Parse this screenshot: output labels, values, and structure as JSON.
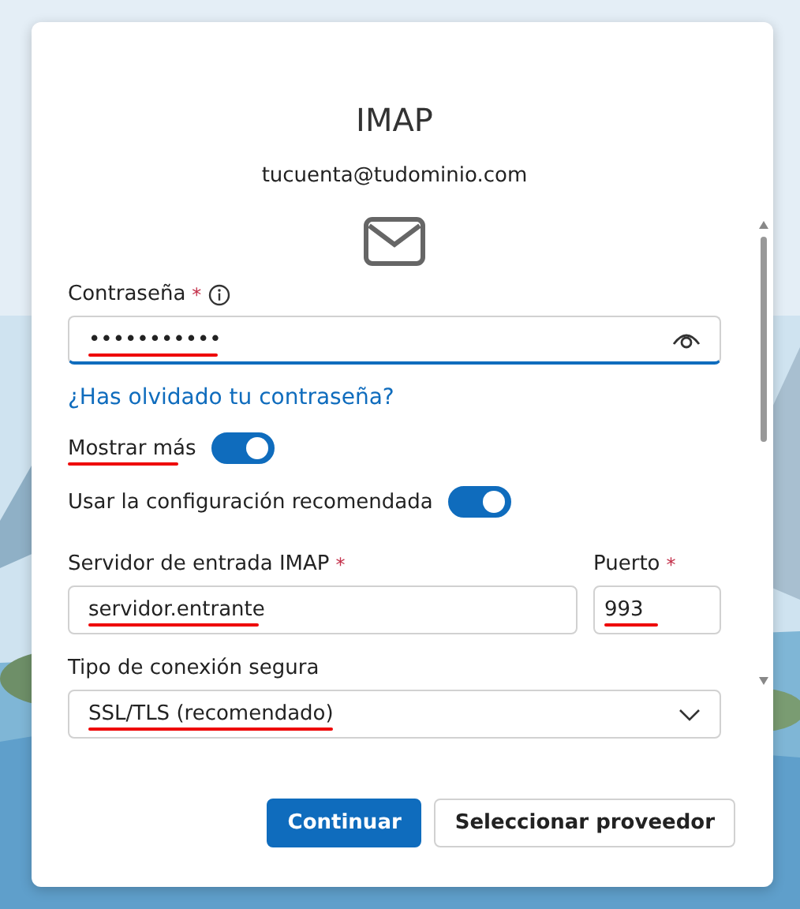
{
  "dialog": {
    "title": "IMAP",
    "account": "tucuenta@tudominio.com"
  },
  "password": {
    "label": "Contraseña",
    "required_mark": "*",
    "value": "•••••••••••",
    "underlined": true
  },
  "forgot_link": "¿Has olvidado tu contraseña?",
  "toggles": [
    {
      "label": "Mostrar más",
      "on": true,
      "underlined": true
    },
    {
      "label": "Usar la configuración recomendada",
      "on": true
    }
  ],
  "server": {
    "label": "Servidor de entrada IMAP",
    "required_mark": "*",
    "value": "servidor.entrante",
    "underlined": true
  },
  "port": {
    "label": "Puerto",
    "required_mark": "*",
    "value": "993",
    "underlined": true
  },
  "connection": {
    "label": "Tipo de conexión segura",
    "value": "SSL/TLS (recomendado)",
    "underlined": true
  },
  "buttons": [
    {
      "label": "Continuar",
      "kind": "primary"
    },
    {
      "label": "Seleccionar proveedor",
      "kind": "secondary"
    }
  ]
}
